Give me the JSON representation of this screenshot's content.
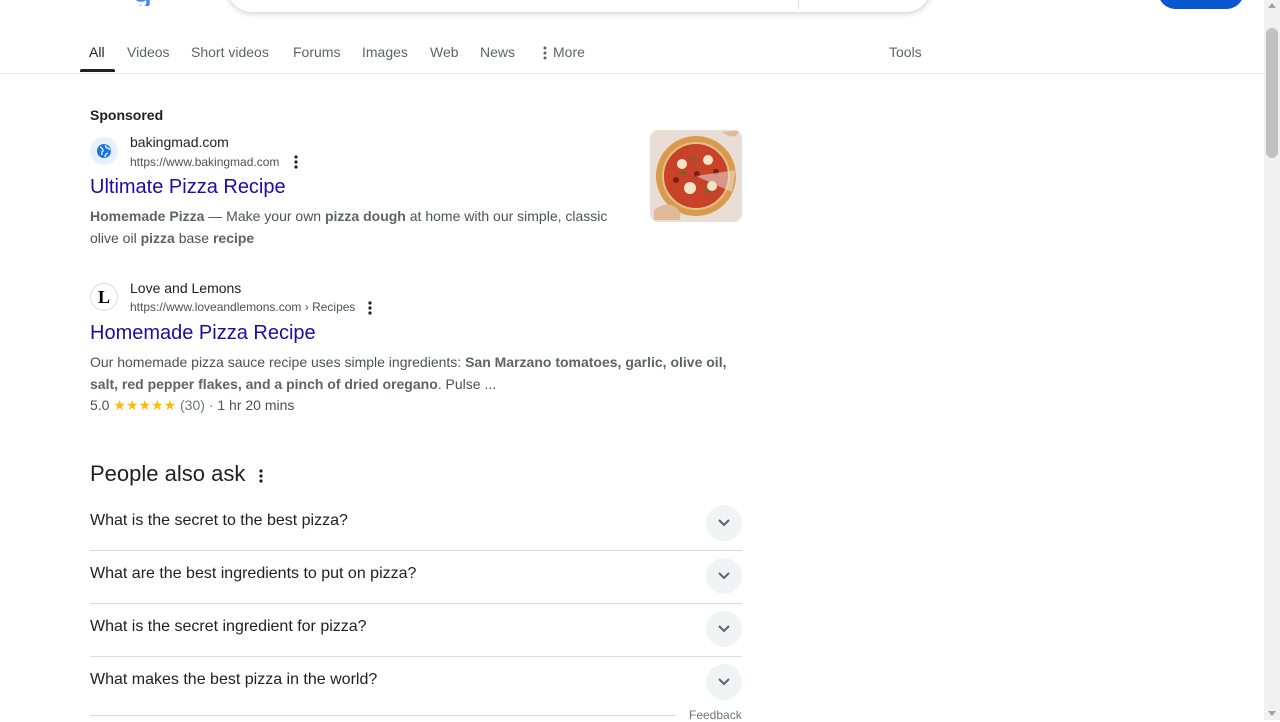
{
  "header": {
    "logo_icon": "google-logo",
    "search_icon": "search-icon",
    "profile_icon": "account-icon"
  },
  "tabs": [
    {
      "label": "All",
      "active": true
    },
    {
      "label": "Videos"
    },
    {
      "label": "Short videos"
    },
    {
      "label": "Forums"
    },
    {
      "label": "Images"
    },
    {
      "label": "Web"
    },
    {
      "label": "News"
    },
    {
      "label": "More"
    }
  ],
  "tools_label": "Tools",
  "sponsored_label": "Sponsored",
  "ads": [
    {
      "site_name": "bakingmad.com",
      "url": "https://www.bakingmad.com",
      "title": "Ultimate Pizza Recipe",
      "favicon_icon": "globe-icon",
      "snippet": {
        "b1": "Homemade Pizza",
        "t1": " — Make your own ",
        "b2": "pizza dough",
        "t2": " at home with our simple, classic olive oil ",
        "b3": "pizza",
        "t3": " base ",
        "b4": "recipe"
      },
      "thumbnail_icon": "pizza-image"
    },
    {
      "site_name": "Love and Lemons",
      "url": "https://www.loveandlemons.com › Recipes",
      "title": "Homemade Pizza Recipe",
      "favicon_letter": "L",
      "snippet": {
        "t1": "Our homemade pizza sauce recipe uses simple ingredients: ",
        "b1": "San Marzano tomatoes, garlic, olive oil, salt, red pepper flakes, and a pinch of dried oregano",
        "t2": ". Pulse ..."
      },
      "rating": {
        "score": "5.0",
        "stars": "★★★★★",
        "count": "(30)",
        "separator": "·",
        "time": "1 hr 20 mins"
      }
    }
  ],
  "people_also_ask": {
    "title": "People also ask",
    "questions": [
      "What is the secret to the best pizza?",
      "What are the best ingredients to put on pizza?",
      "What is the secret ingredient for pizza?",
      "What makes the best pizza in the world?"
    ],
    "feedback_label": "Feedback"
  },
  "colors": {
    "link": "#1a0dab",
    "accent": "#0b57d0",
    "star": "#fbbc04"
  }
}
